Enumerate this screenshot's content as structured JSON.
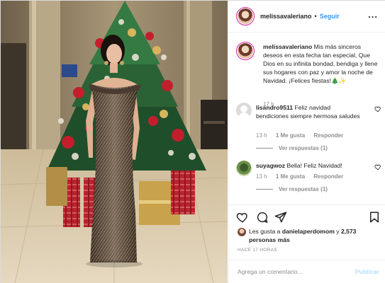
{
  "post": {
    "username": "melissavaleriano",
    "follow_label": "Seguir",
    "dot": "•",
    "more_label": "...",
    "caption": {
      "username": "melissavaleriano",
      "text": "Mis más sinceros deseos en esta fecha tan especial, Que Dios en su infinita bondad, bendiga y llene sus hogares con paz y amor la noche de Navidad. ¡Felices fiestas!🎄✨",
      "time": "17 h"
    },
    "comments": [
      {
        "username": "lisandro9511",
        "text": "Feliz navidad bendiciones siempre hermosa saludes",
        "time": "13 h",
        "likes": "1 Me gusta",
        "reply": "Responder",
        "view_replies": "Ver respuestas (1)"
      },
      {
        "username": "suyagwoz",
        "text": "Bella! Feliz Navidad!",
        "time": "13 h",
        "likes": "1 Me gusta",
        "reply": "Responder",
        "view_replies": "Ver respuestas (1)"
      }
    ],
    "likes": {
      "prefix": "Les gusta a",
      "liker": "danielaperdomom",
      "join": "y",
      "others": "2,573 personas más"
    },
    "time_ago": "HACE 17 HORAS",
    "add_comment": {
      "placeholder": "Agrega un comentario...",
      "publish": "Publicar"
    }
  },
  "colors": {
    "accent": "#3897f0",
    "publish_disabled": "#b2dffc",
    "muted": "#8e8e8e",
    "border": "#efefef"
  },
  "icons": [
    "heart-icon",
    "comment-icon",
    "share-icon",
    "bookmark-icon",
    "more-icon"
  ]
}
